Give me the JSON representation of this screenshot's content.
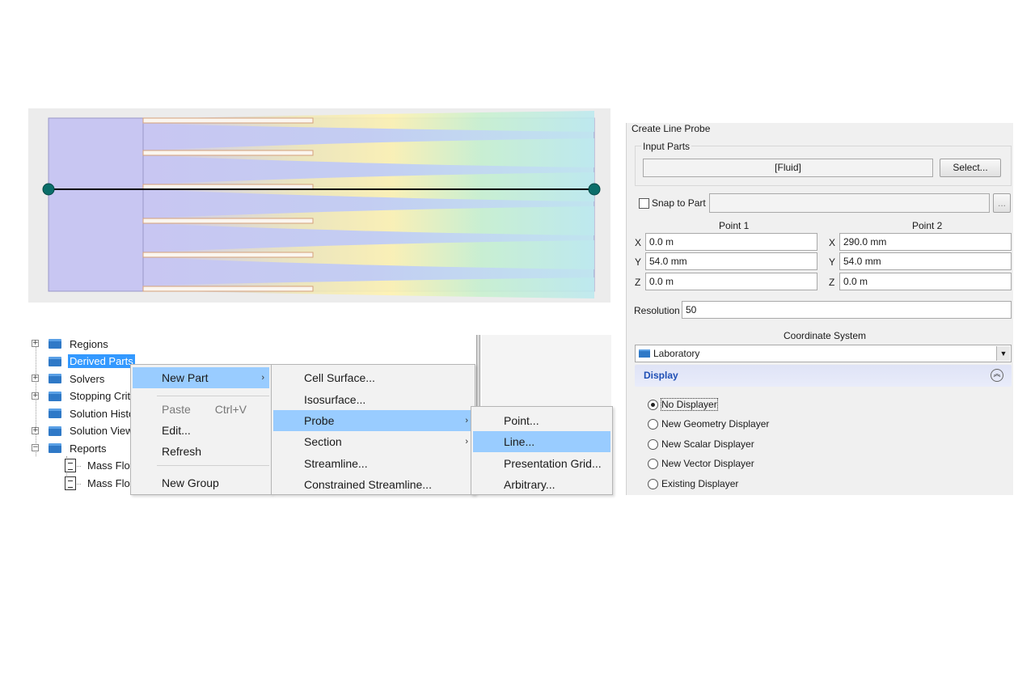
{
  "flow_view": {
    "probe_line_color": "#000000",
    "probe_handle_color": "#0b6e6a",
    "fluid_base_color": "#c8c6f2",
    "jet_color_core": "#fff3b0",
    "jet_color_mid": "#c9f1cf",
    "jet_color_outer": "#bde9ef"
  },
  "tree": {
    "items": [
      {
        "label": "Regions",
        "expander": "+",
        "kind": "folder"
      },
      {
        "label": "Derived Parts",
        "expander": "",
        "kind": "folder",
        "selected": true
      },
      {
        "label": "Solvers",
        "expander": "+",
        "kind": "folder"
      },
      {
        "label": "Stopping Crit",
        "expander": "+",
        "kind": "folder"
      },
      {
        "label": "Solution Histo",
        "expander": "",
        "kind": "folder"
      },
      {
        "label": "Solution View",
        "expander": "+",
        "kind": "folder"
      },
      {
        "label": "Reports",
        "expander": "−",
        "kind": "folder"
      },
      {
        "label": "Mass Flov",
        "expander": "",
        "kind": "report"
      },
      {
        "label": "Mass Flov",
        "expander": "",
        "kind": "report"
      }
    ]
  },
  "context_menu": {
    "items": [
      {
        "label": "New Part",
        "shortcut": "",
        "arrow": "›",
        "highlight": true,
        "disabled": false
      },
      {
        "label": "Paste",
        "shortcut": "Ctrl+V",
        "arrow": "",
        "highlight": false,
        "disabled": true
      },
      {
        "label": "Edit...",
        "shortcut": "",
        "arrow": "",
        "highlight": false,
        "disabled": false
      },
      {
        "label": "Refresh",
        "shortcut": "",
        "arrow": "",
        "highlight": false,
        "disabled": false
      },
      {
        "label": "New Group",
        "shortcut": "",
        "arrow": "",
        "highlight": false,
        "disabled": false
      }
    ]
  },
  "new_part_menu": {
    "items": [
      {
        "label": "Cell Surface...",
        "arrow": "",
        "highlight": false
      },
      {
        "label": "Isosurface...",
        "arrow": "",
        "highlight": false
      },
      {
        "label": "Probe",
        "arrow": "›",
        "highlight": true
      },
      {
        "label": "Section",
        "arrow": "›",
        "highlight": false
      },
      {
        "label": "Streamline...",
        "arrow": "",
        "highlight": false
      },
      {
        "label": "Constrained Streamline...",
        "arrow": "",
        "highlight": false
      }
    ]
  },
  "probe_menu": {
    "items": [
      {
        "label": "Point...",
        "highlight": false
      },
      {
        "label": "Line...",
        "highlight": true
      },
      {
        "label": "Presentation Grid...",
        "highlight": false
      },
      {
        "label": "Arbitrary...",
        "highlight": false
      }
    ]
  },
  "create_line_probe": {
    "title": "Create Line Probe",
    "input_parts_label": "Input Parts",
    "input_parts_value": "[Fluid]",
    "select_button": "Select...",
    "snap_to_part_label": "Snap to Part",
    "snap_to_part_checked": false,
    "snap_browse_button": "...",
    "point1_label": "Point 1",
    "point2_label": "Point 2",
    "point1": {
      "x_label": "X",
      "x": "0.0 m",
      "y_label": "Y",
      "y": "54.0 mm",
      "z_label": "Z",
      "z": "0.0 m"
    },
    "point2": {
      "x_label": "X",
      "x": "290.0 mm",
      "y_label": "Y",
      "y": "54.0 mm",
      "z_label": "Z",
      "z": "0.0 m"
    },
    "resolution_label": "Resolution",
    "resolution_value": "50",
    "coordinate_system_label": "Coordinate System",
    "coordinate_system_value": "Laboratory",
    "display_header": "Display",
    "display_options": [
      {
        "label": "No Displayer",
        "checked": true
      },
      {
        "label": "New Geometry Displayer",
        "checked": false
      },
      {
        "label": "New Scalar Displayer",
        "checked": false
      },
      {
        "label": "New Vector Displayer",
        "checked": false
      },
      {
        "label": "Existing Displayer",
        "checked": false
      }
    ]
  }
}
